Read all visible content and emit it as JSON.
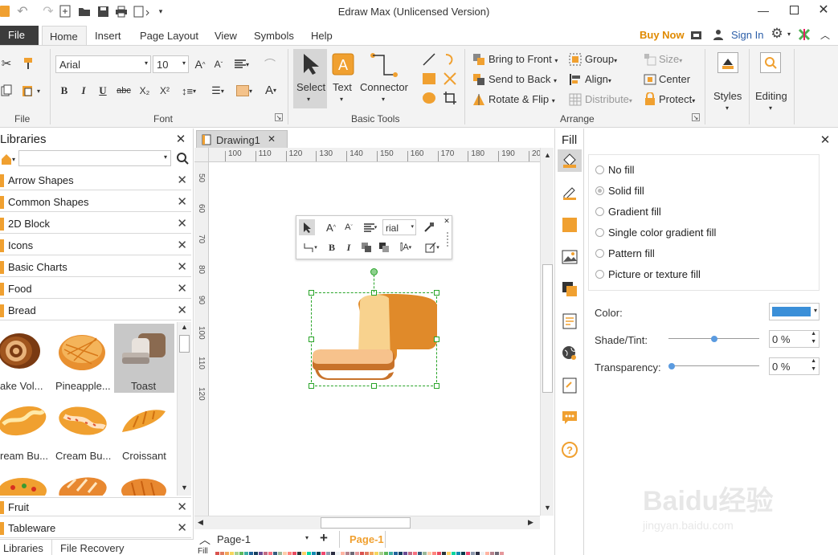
{
  "window": {
    "title": "Edraw Max (Unlicensed Version)"
  },
  "menu": {
    "file": "File",
    "tabs": [
      "Home",
      "Insert",
      "Page Layout",
      "View",
      "Symbols",
      "Help"
    ],
    "buy_now": "Buy Now",
    "sign_in": "Sign In"
  },
  "ribbon": {
    "font_name": "Arial",
    "font_size": "10",
    "groups": {
      "file": "File",
      "font": "Font",
      "basic_tools": "Basic Tools",
      "arrange": "Arrange"
    },
    "tools": {
      "select": "Select",
      "text": "Text",
      "connector": "Connector"
    },
    "arrange": {
      "bring_front": "Bring to Front",
      "send_back": "Send to Back",
      "rotate_flip": "Rotate & Flip",
      "group": "Group",
      "align": "Align",
      "distribute": "Distribute",
      "size": "Size",
      "center": "Center",
      "protect": "Protect"
    },
    "styles": "Styles",
    "editing": "Editing",
    "format_buttons": [
      "B",
      "I",
      "U",
      "abc",
      "X₂",
      "X²"
    ]
  },
  "libraries": {
    "title": "Libraries",
    "categories": [
      "Arrow Shapes",
      "Common Shapes",
      "2D Block",
      "Icons",
      "Basic Charts",
      "Food",
      "Bread"
    ],
    "items": [
      "ake Vol...",
      "Pineapple...",
      "Toast",
      "ream Bu...",
      "Cream Bu...",
      "Croissant"
    ],
    "bottom_categories": [
      "Fruit",
      "Tableware"
    ],
    "bottom_tabs": [
      "Libraries",
      "File Recovery"
    ]
  },
  "canvas": {
    "tab": "Drawing1",
    "ruler_h": [
      "100",
      "110",
      "120",
      "130",
      "140",
      "150",
      "160",
      "170",
      "180",
      "190",
      "20"
    ],
    "ruler_v": [
      "50",
      "60",
      "70",
      "80",
      "90",
      "100",
      "110",
      "120"
    ],
    "float_font": "rial",
    "page_select": "Page-1",
    "page_tab": "Page-1",
    "fill_label": "Fill"
  },
  "fill_panel": {
    "title": "Fill",
    "options": [
      "No fill",
      "Solid fill",
      "Gradient fill",
      "Single color gradient fill",
      "Pattern fill",
      "Picture or texture fill"
    ],
    "selected": "Solid fill",
    "color_label": "Color:",
    "color_value": "#3a8fd8",
    "shade_label": "Shade/Tint:",
    "shade_value": "0 %",
    "shade_level": 0.5,
    "transparency_label": "Transparency:",
    "transparency_value": "0 %",
    "transparency_level": 0
  },
  "watermark": {
    "brand": "Baidu经验",
    "url": "jingyan.baidu.com"
  },
  "colors": {
    "accent_orange": "#f0a030",
    "ribbon_bg": "#f3f3f3",
    "file_tab": "#3c3c3c",
    "selection": "#28a428"
  }
}
